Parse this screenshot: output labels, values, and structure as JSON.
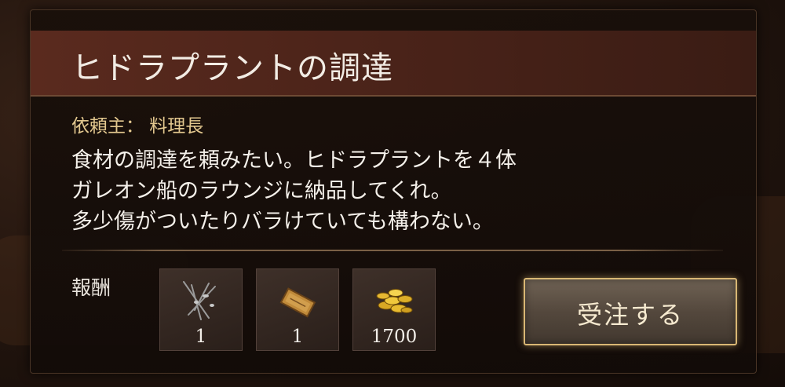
{
  "quest": {
    "title": "ヒドラプラントの調達",
    "client": "依頼主： 料理長",
    "description": [
      "食材の調達を頼みたい。ヒドラプラントを４体",
      "ガレオン船のラウンジに納品してくれ。",
      "多少傷がついたりバラけていても構わない。"
    ]
  },
  "rewards": {
    "label": "報酬",
    "items": [
      {
        "icon": "herb-sticks-icon",
        "count": "1"
      },
      {
        "icon": "scroll-ticket-icon",
        "count": "1"
      },
      {
        "icon": "gold-coins-icon",
        "count": "1700"
      }
    ]
  },
  "actions": {
    "accept_label": "受注する"
  },
  "colors": {
    "title_bar": "#4a2319",
    "client_text": "#e3c88f",
    "button_border": "#d9b774"
  }
}
